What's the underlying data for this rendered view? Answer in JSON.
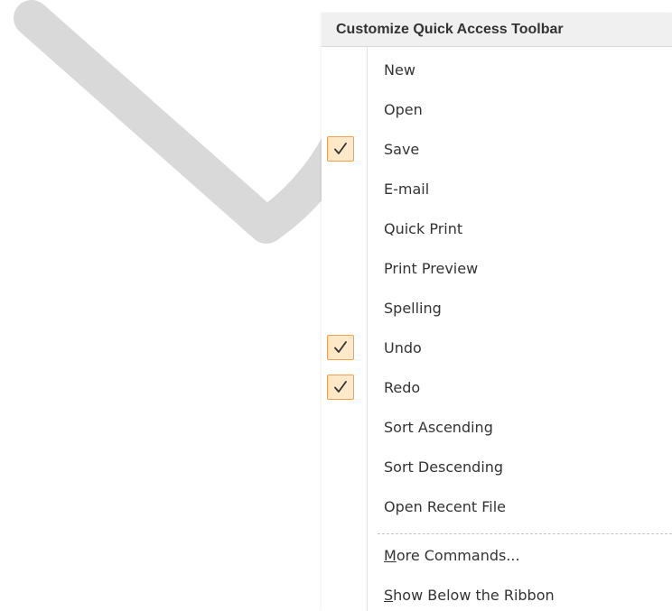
{
  "menu": {
    "title": "Customize Quick Access Toolbar",
    "items": [
      {
        "label": "New",
        "checked": false
      },
      {
        "label": "Open",
        "checked": false
      },
      {
        "label": "Save",
        "checked": true
      },
      {
        "label": "E-mail",
        "checked": false
      },
      {
        "label": "Quick Print",
        "checked": false
      },
      {
        "label": "Print Preview",
        "checked": false
      },
      {
        "label": "Spelling",
        "checked": false
      },
      {
        "label": "Undo",
        "checked": true
      },
      {
        "label": "Redo",
        "checked": true
      },
      {
        "label": "Sort Ascending",
        "checked": false
      },
      {
        "label": "Sort Descending",
        "checked": false
      },
      {
        "label": "Open Recent File",
        "checked": false
      }
    ],
    "more_commands": {
      "accel": "M",
      "rest": "ore Commands..."
    },
    "show_below": {
      "accel": "S",
      "rest": "how Below the Ribbon"
    }
  },
  "colors": {
    "check_border": "#f0a050",
    "check_fill": "#fde8c8",
    "header_bg": "#f0f0f0",
    "background_shape": "#d9d9d9"
  },
  "icons": {
    "check": "checkmark-icon",
    "background": "document-watermark-shape"
  }
}
